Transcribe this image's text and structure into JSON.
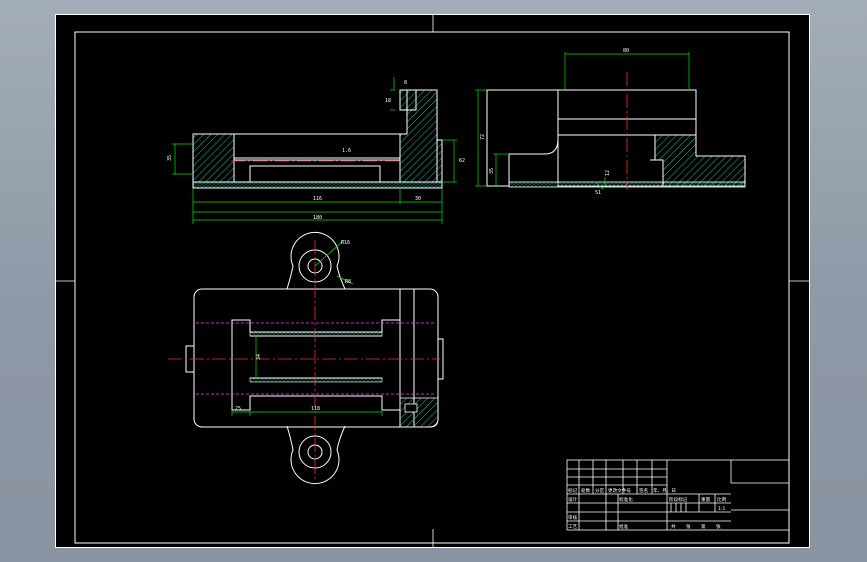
{
  "drawing": {
    "front_view": {
      "dims": {
        "left_height": "35",
        "slot": "8",
        "slot_depth": "18",
        "chamfer": "1.6",
        "right_height": "62",
        "inner_length": "116",
        "total_length": "180",
        "step": "30"
      }
    },
    "side_view": {
      "dims": {
        "top_width": "80",
        "height": "72",
        "base_height": "35",
        "base_offset": "51",
        "groove": "12"
      }
    },
    "top_view": {
      "dims": {
        "boss_radius": "R16",
        "fillet": "R8",
        "slot_left": "25",
        "slot_length": "118",
        "slot_width": "34"
      }
    }
  },
  "colors": {
    "background": "#000000",
    "outline": "#ffffff",
    "centerline": "#ff2a2a",
    "dimension": "#00e600",
    "hidden": "#ff3cff",
    "hatch": "#18d4b4"
  },
  "title_block": {
    "row1": [
      "标记",
      "处数",
      "分区",
      "更改文件号",
      "签名",
      "年、月、日"
    ],
    "row2": [
      "设计",
      "",
      "标准化",
      ""
    ],
    "row3": [
      "审核",
      ""
    ],
    "row4": [
      "工艺",
      "",
      "批准",
      ""
    ],
    "stage_labels": [
      "阶段标记",
      "重量",
      "比例"
    ],
    "scale": "1:1",
    "sheet_labels": [
      "共",
      "张",
      "第",
      "张"
    ]
  }
}
